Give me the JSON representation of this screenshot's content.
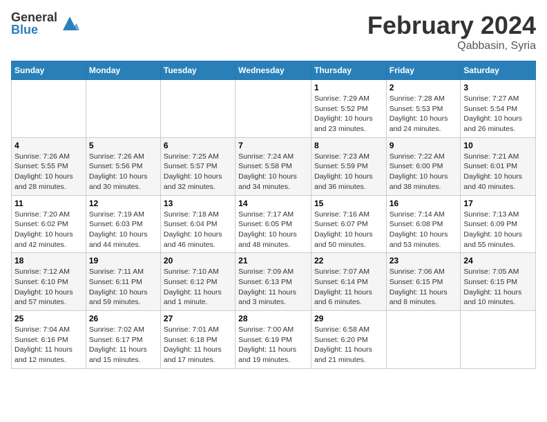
{
  "logo": {
    "general": "General",
    "blue": "Blue"
  },
  "title": {
    "month_year": "February 2024",
    "location": "Qabbasin, Syria"
  },
  "weekdays": [
    "Sunday",
    "Monday",
    "Tuesday",
    "Wednesday",
    "Thursday",
    "Friday",
    "Saturday"
  ],
  "weeks": [
    [
      {
        "day": "",
        "info": ""
      },
      {
        "day": "",
        "info": ""
      },
      {
        "day": "",
        "info": ""
      },
      {
        "day": "",
        "info": ""
      },
      {
        "day": "1",
        "info": "Sunrise: 7:29 AM\nSunset: 5:52 PM\nDaylight: 10 hours\nand 23 minutes."
      },
      {
        "day": "2",
        "info": "Sunrise: 7:28 AM\nSunset: 5:53 PM\nDaylight: 10 hours\nand 24 minutes."
      },
      {
        "day": "3",
        "info": "Sunrise: 7:27 AM\nSunset: 5:54 PM\nDaylight: 10 hours\nand 26 minutes."
      }
    ],
    [
      {
        "day": "4",
        "info": "Sunrise: 7:26 AM\nSunset: 5:55 PM\nDaylight: 10 hours\nand 28 minutes."
      },
      {
        "day": "5",
        "info": "Sunrise: 7:26 AM\nSunset: 5:56 PM\nDaylight: 10 hours\nand 30 minutes."
      },
      {
        "day": "6",
        "info": "Sunrise: 7:25 AM\nSunset: 5:57 PM\nDaylight: 10 hours\nand 32 minutes."
      },
      {
        "day": "7",
        "info": "Sunrise: 7:24 AM\nSunset: 5:58 PM\nDaylight: 10 hours\nand 34 minutes."
      },
      {
        "day": "8",
        "info": "Sunrise: 7:23 AM\nSunset: 5:59 PM\nDaylight: 10 hours\nand 36 minutes."
      },
      {
        "day": "9",
        "info": "Sunrise: 7:22 AM\nSunset: 6:00 PM\nDaylight: 10 hours\nand 38 minutes."
      },
      {
        "day": "10",
        "info": "Sunrise: 7:21 AM\nSunset: 6:01 PM\nDaylight: 10 hours\nand 40 minutes."
      }
    ],
    [
      {
        "day": "11",
        "info": "Sunrise: 7:20 AM\nSunset: 6:02 PM\nDaylight: 10 hours\nand 42 minutes."
      },
      {
        "day": "12",
        "info": "Sunrise: 7:19 AM\nSunset: 6:03 PM\nDaylight: 10 hours\nand 44 minutes."
      },
      {
        "day": "13",
        "info": "Sunrise: 7:18 AM\nSunset: 6:04 PM\nDaylight: 10 hours\nand 46 minutes."
      },
      {
        "day": "14",
        "info": "Sunrise: 7:17 AM\nSunset: 6:05 PM\nDaylight: 10 hours\nand 48 minutes."
      },
      {
        "day": "15",
        "info": "Sunrise: 7:16 AM\nSunset: 6:07 PM\nDaylight: 10 hours\nand 50 minutes."
      },
      {
        "day": "16",
        "info": "Sunrise: 7:14 AM\nSunset: 6:08 PM\nDaylight: 10 hours\nand 53 minutes."
      },
      {
        "day": "17",
        "info": "Sunrise: 7:13 AM\nSunset: 6:09 PM\nDaylight: 10 hours\nand 55 minutes."
      }
    ],
    [
      {
        "day": "18",
        "info": "Sunrise: 7:12 AM\nSunset: 6:10 PM\nDaylight: 10 hours\nand 57 minutes."
      },
      {
        "day": "19",
        "info": "Sunrise: 7:11 AM\nSunset: 6:11 PM\nDaylight: 10 hours\nand 59 minutes."
      },
      {
        "day": "20",
        "info": "Sunrise: 7:10 AM\nSunset: 6:12 PM\nDaylight: 11 hours\nand 1 minute."
      },
      {
        "day": "21",
        "info": "Sunrise: 7:09 AM\nSunset: 6:13 PM\nDaylight: 11 hours\nand 3 minutes."
      },
      {
        "day": "22",
        "info": "Sunrise: 7:07 AM\nSunset: 6:14 PM\nDaylight: 11 hours\nand 6 minutes."
      },
      {
        "day": "23",
        "info": "Sunrise: 7:06 AM\nSunset: 6:15 PM\nDaylight: 11 hours\nand 8 minutes."
      },
      {
        "day": "24",
        "info": "Sunrise: 7:05 AM\nSunset: 6:15 PM\nDaylight: 11 hours\nand 10 minutes."
      }
    ],
    [
      {
        "day": "25",
        "info": "Sunrise: 7:04 AM\nSunset: 6:16 PM\nDaylight: 11 hours\nand 12 minutes."
      },
      {
        "day": "26",
        "info": "Sunrise: 7:02 AM\nSunset: 6:17 PM\nDaylight: 11 hours\nand 15 minutes."
      },
      {
        "day": "27",
        "info": "Sunrise: 7:01 AM\nSunset: 6:18 PM\nDaylight: 11 hours\nand 17 minutes."
      },
      {
        "day": "28",
        "info": "Sunrise: 7:00 AM\nSunset: 6:19 PM\nDaylight: 11 hours\nand 19 minutes."
      },
      {
        "day": "29",
        "info": "Sunrise: 6:58 AM\nSunset: 6:20 PM\nDaylight: 11 hours\nand 21 minutes."
      },
      {
        "day": "",
        "info": ""
      },
      {
        "day": "",
        "info": ""
      }
    ]
  ]
}
